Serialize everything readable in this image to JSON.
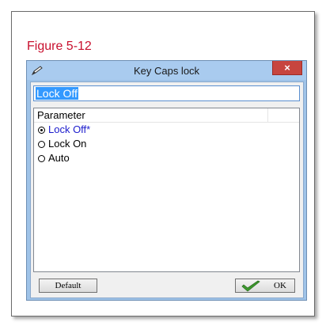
{
  "figure": {
    "caption": "Figure 5-12"
  },
  "dialog": {
    "title": "Key Caps lock",
    "icon": "pencil-icon",
    "close_label": "×",
    "name_value": "Lock Off",
    "list": {
      "header": "Parameter",
      "options": [
        {
          "label": "Lock Off*",
          "selected": true
        },
        {
          "label": "Lock On",
          "selected": false
        },
        {
          "label": "Auto",
          "selected": false
        }
      ]
    },
    "default_button": "Default",
    "ok_button": "OK"
  },
  "colors": {
    "caption": "#c8102e",
    "titlebar": "#a9cbef",
    "close_button": "#c7453f",
    "selected_option": "#1a1acc",
    "selection_highlight": "#3399ff",
    "ok_check": "#3d9a2e"
  }
}
